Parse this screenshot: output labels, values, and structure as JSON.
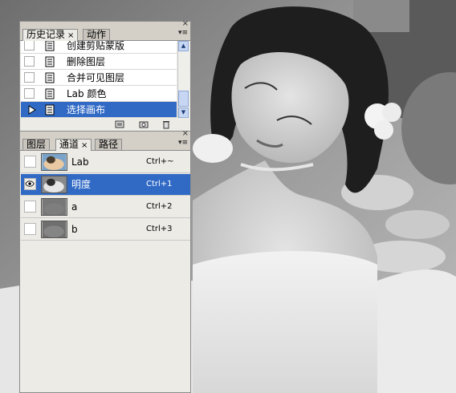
{
  "history_panel": {
    "tabs": [
      {
        "label": "历史记录",
        "close": "×",
        "active": true
      },
      {
        "label": "动作",
        "close": "",
        "active": false
      }
    ],
    "menu_glyph": "▾≡",
    "items": [
      {
        "label": "创建剪贴蒙版",
        "selected": false
      },
      {
        "label": "删除图层",
        "selected": false
      },
      {
        "label": "合并可见图层",
        "selected": false
      },
      {
        "label": "Lab 颜色",
        "selected": false
      },
      {
        "label": "选择画布",
        "selected": true
      }
    ],
    "footer_icons": [
      "new-document-from-state-icon",
      "snapshot-camera-icon",
      "trash-icon"
    ]
  },
  "channels_panel": {
    "tabs": [
      {
        "label": "图层",
        "close": "",
        "active": false
      },
      {
        "label": "通道",
        "close": "×",
        "active": true
      },
      {
        "label": "路径",
        "close": "",
        "active": false
      }
    ],
    "menu_glyph": "▾≡",
    "channels": [
      {
        "name": "Lab",
        "shortcut": "Ctrl+~",
        "visible": false,
        "selected": false
      },
      {
        "name": "明度",
        "shortcut": "Ctrl+1",
        "visible": true,
        "selected": true
      },
      {
        "name": "a",
        "shortcut": "Ctrl+2",
        "visible": false,
        "selected": false
      },
      {
        "name": "b",
        "shortcut": "Ctrl+3",
        "visible": false,
        "selected": false
      }
    ]
  },
  "colors": {
    "selection": "#316ac5",
    "panel_bg": "#ecebe6"
  }
}
